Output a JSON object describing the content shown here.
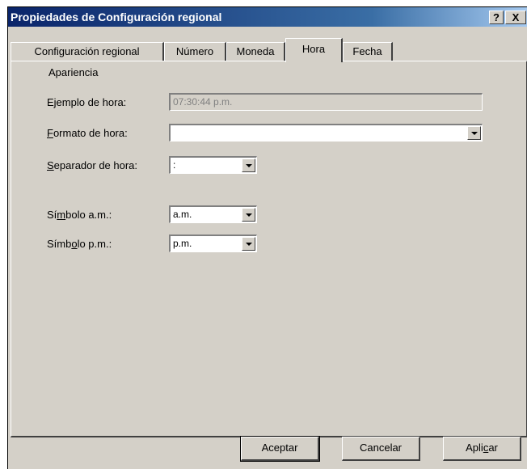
{
  "window": {
    "title": "Propiedades de Configuración regional",
    "help_label": "?",
    "close_label": "X"
  },
  "tabs": [
    {
      "label": "Configuración regional"
    },
    {
      "label": "Número"
    },
    {
      "label": "Moneda"
    },
    {
      "label": "Hora",
      "active": true
    },
    {
      "label": "Fecha"
    }
  ],
  "appearance": {
    "group_label": "Apariencia",
    "sample": {
      "label": "Ejemplo de hora:",
      "value": "07:30:44 p.m."
    },
    "format": {
      "label_pre": "",
      "label_key": "F",
      "label_post": "ormato de hora:",
      "value": ""
    },
    "separator": {
      "label_pre": "",
      "label_key": "S",
      "label_post": "eparador de hora:",
      "value": ":"
    }
  },
  "am": {
    "label_pre": "Sí",
    "label_key": "m",
    "label_post": "bolo a.m.:",
    "value": "a.m."
  },
  "pm": {
    "label_pre": "Símb",
    "label_key": "o",
    "label_post": "lo p.m.:",
    "value": "p.m."
  },
  "buttons": {
    "ok": "Aceptar",
    "cancel": "Cancelar",
    "apply_pre": "Apli",
    "apply_key": "c",
    "apply_post": "ar"
  },
  "icons": {
    "dropdown": "chevron-down-icon"
  }
}
